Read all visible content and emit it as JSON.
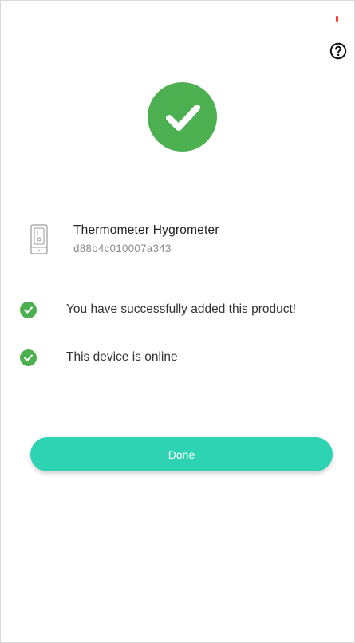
{
  "theme": {
    "accent": "#2ed3b3",
    "success": "#4caf50",
    "status_dot": "#ff3b30"
  },
  "header": {
    "help_icon": "help-circle-icon"
  },
  "result": {
    "badge_icon": "checkmark-icon"
  },
  "device": {
    "icon": "thermometer-hygrometer-device-icon",
    "name": "Thermometer Hygrometer",
    "id": "d88b4c010007a343"
  },
  "statuses": [
    {
      "icon": "check-circle-icon",
      "text": "You have successfully added this product!"
    },
    {
      "icon": "check-circle-icon",
      "text": "This device is online"
    }
  ],
  "actions": {
    "done_label": "Done"
  }
}
